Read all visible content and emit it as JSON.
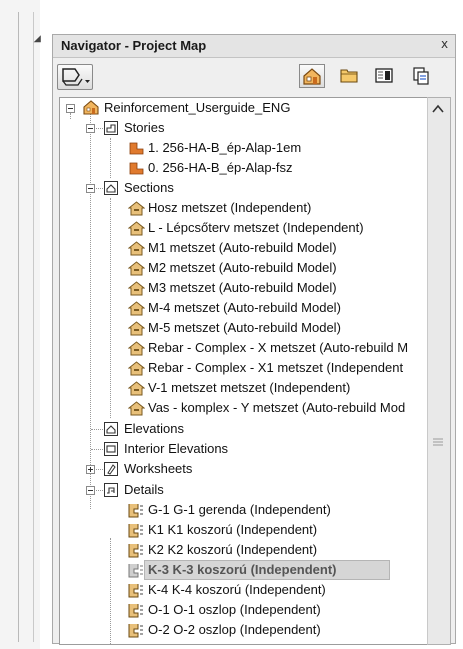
{
  "panel": {
    "title": "Navigator - Project Map",
    "close_glyph": "x"
  },
  "toolbar": {
    "buttons": [
      {
        "name": "popup-navigator-icon",
        "active": true
      },
      {
        "name": "project-map-icon",
        "active": true
      },
      {
        "name": "view-map-icon",
        "active": false
      },
      {
        "name": "layout-book-icon",
        "active": false
      },
      {
        "name": "publisher-icon",
        "active": false
      }
    ]
  },
  "tree": {
    "root": {
      "label": "Reinforcement_Userguide_ENG",
      "icon": "house-icon"
    },
    "stories": {
      "label": "Stories",
      "items": [
        {
          "label": "1. 256-HA-B_ép-Alap-1em"
        },
        {
          "label": "0. 256-HA-B_ép-Alap-fsz"
        }
      ]
    },
    "sections": {
      "label": "Sections",
      "items": [
        {
          "label": "Hosz metszet (Independent)"
        },
        {
          "label": "L - Lépcsőterv metszet (Independent)"
        },
        {
          "label": "M1 metszet (Auto-rebuild Model)"
        },
        {
          "label": "M2 metszet (Auto-rebuild Model)"
        },
        {
          "label": "M3 metszet (Auto-rebuild Model)"
        },
        {
          "label": "M-4 metszet (Auto-rebuild Model)"
        },
        {
          "label": "M-5 metszet (Auto-rebuild Model)"
        },
        {
          "label": "Rebar - Complex - X metszet (Auto-rebuild M"
        },
        {
          "label": "Rebar - Complex - X1 metszet (Independent"
        },
        {
          "label": "V-1 metszet metszet (Independent)"
        },
        {
          "label": "Vas - komplex - Y metszet (Auto-rebuild Mod"
        }
      ]
    },
    "elevations": {
      "label": "Elevations"
    },
    "interior_elevations": {
      "label": "Interior Elevations"
    },
    "worksheets": {
      "label": "Worksheets"
    },
    "details": {
      "label": "Details",
      "items": [
        {
          "label": "G-1 G-1 gerenda (Independent)",
          "selected": false
        },
        {
          "label": "K1 K1 koszorú (Independent)",
          "selected": false
        },
        {
          "label": "K2 K2 koszorú (Independent)",
          "selected": false
        },
        {
          "label": "K-3 K-3 koszorú (Independent)",
          "selected": true
        },
        {
          "label": "K-4 K-4 koszorú (Independent)",
          "selected": false
        },
        {
          "label": "O-1 O-1 oszlop (Independent)",
          "selected": false
        },
        {
          "label": "O-2 O-2 oszlop (Independent)",
          "selected": false
        }
      ]
    }
  },
  "colors": {
    "story_icon": "#e07a2e",
    "section_icon": "#d9a35a",
    "selection": "#d6d6d6"
  }
}
